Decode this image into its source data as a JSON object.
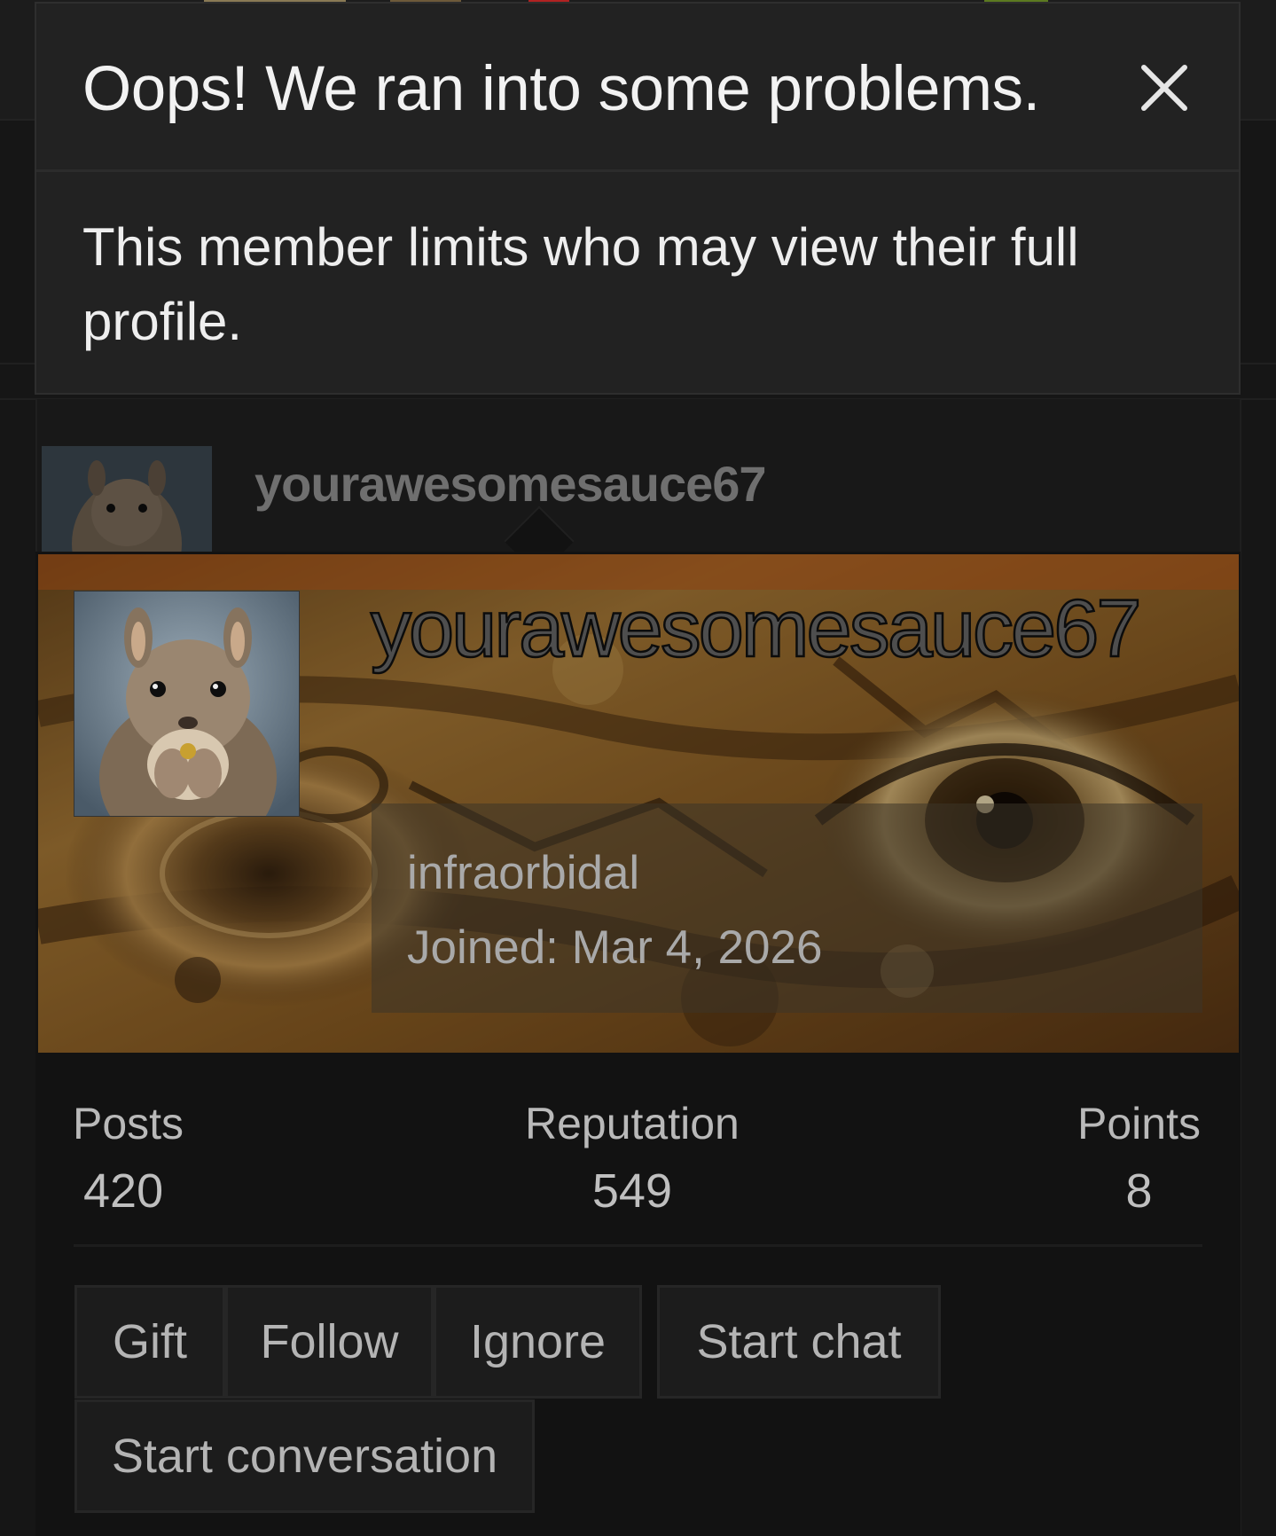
{
  "modal": {
    "title": "Oops! We ran into some problems.",
    "close_icon": "close-icon",
    "message": "This member limits who may view their full profile."
  },
  "background": {
    "username": "yourawesomesauce67"
  },
  "profile": {
    "username": "yourawesomesauce67",
    "user_title": "infraorbidal",
    "joined": "Joined: Mar 4, 2026",
    "avatar_icon": "squirrel-avatar",
    "stats": [
      {
        "label": "Posts",
        "value": "420"
      },
      {
        "label": "Reputation",
        "value": "549"
      },
      {
        "label": "Points",
        "value": "8"
      }
    ],
    "actions": {
      "gift": "Gift",
      "follow": "Follow",
      "ignore": "Ignore",
      "start_chat": "Start chat",
      "start_conversation": "Start conversation"
    }
  },
  "colors": {
    "page_bg": "#141414",
    "modal_bg": "#222222",
    "banner_tone": "#8a5a1e"
  }
}
